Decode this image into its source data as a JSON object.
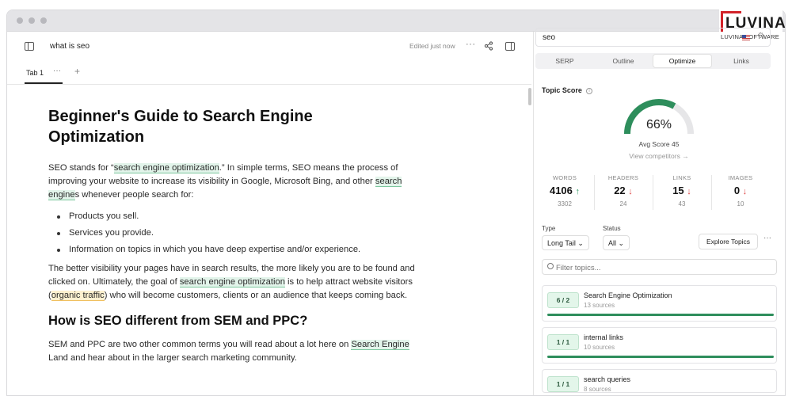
{
  "logo": {
    "word": "LUVINA",
    "sub": "LUVINA SOFTWARE"
  },
  "editor": {
    "doc_title": "what is seo",
    "edited_status": "Edited just now",
    "more": "···",
    "tab_label": "Tab 1",
    "tab_more": "···",
    "tab_add": "+"
  },
  "doc": {
    "h1": "Beginner's Guide to Search Engine Optimization",
    "p1": {
      "a": "SEO stands for “",
      "b": "search engine optimization",
      "c": ".” In simple terms, SEO means the process of improving your website to increase its visibility in Google, Microsoft Bing, and other ",
      "d": "search engine",
      "e": "s whenever people search for:"
    },
    "bullets": [
      "Products you sell.",
      "Services you provide.",
      "Information on topics in which you have deep expertise and/or experience."
    ],
    "p2": {
      "a": "The better visibility your pages have in search results, the more likely you are to be found and clicked on. Ultimately, the goal of ",
      "b": "search engine optimization",
      "c": " is to help attract website visitors (",
      "d": "organic traffic",
      "e": ") who will become customers, clients or an audience that keeps coming back."
    },
    "h2": "How is SEO different from SEM and PPC?",
    "p3": {
      "a": "SEM and PPC are two other common terms you will read about a lot here on ",
      "b": "Search Engine",
      "c": " Land and hear about in the larger search marketing community."
    }
  },
  "panel": {
    "search_value": "seo",
    "tabs": [
      "SERP",
      "Outline",
      "Optimize",
      "Links"
    ],
    "active_tab": "Optimize",
    "topic_score_label": "Topic Score",
    "score": "66%",
    "score_value": 66,
    "avg_score": "Avg Score 45",
    "view_competitors": "View competitors →",
    "stats": [
      {
        "label": "WORDS",
        "value": "4106",
        "trend": "↑",
        "sub": "3302"
      },
      {
        "label": "HEADERS",
        "value": "22",
        "trend": "↓",
        "sub": "24"
      },
      {
        "label": "LINKS",
        "value": "15",
        "trend": "↓",
        "sub": "43"
      },
      {
        "label": "IMAGES",
        "value": "0",
        "trend": "↓",
        "sub": "10"
      }
    ],
    "type_label": "Type",
    "type_value": "Long Tail ⌄",
    "status_label": "Status",
    "status_value": "All ⌄",
    "explore_button": "Explore Topics",
    "more": "···",
    "filter_placeholder": "Filter topics...",
    "topics": [
      {
        "badge": "6 / 2",
        "name": "Search Engine Optimization",
        "sources": "13 sources"
      },
      {
        "badge": "1 / 1",
        "name": "internal links",
        "sources": "10 sources"
      },
      {
        "badge": "1 / 1",
        "name": "search queries",
        "sources": "8 sources"
      }
    ]
  },
  "colors": {
    "accent_green": "#2e8e5c",
    "down_red": "#dd4444",
    "logo_red": "#d2232a"
  }
}
